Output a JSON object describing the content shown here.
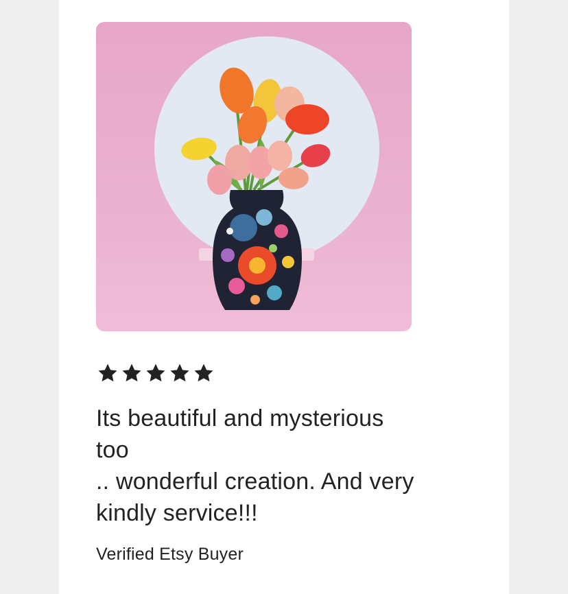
{
  "review": {
    "rating": 5,
    "rating_max": 5,
    "text_lines": [
      "Its beautiful and mysterious",
      "too",
      ".. wonderful creation. And very",
      "kindly service!!!"
    ],
    "author": "Verified Etsy Buyer"
  },
  "photo": {
    "subject": "patterned vase with tulips",
    "background_color": "#eab2cf",
    "disc_color": "#e3e9f2"
  },
  "icons": {
    "star": "star-icon"
  },
  "colors": {
    "star": "#222222",
    "text": "#222222",
    "card": "#ffffff",
    "page": "#efefef"
  }
}
